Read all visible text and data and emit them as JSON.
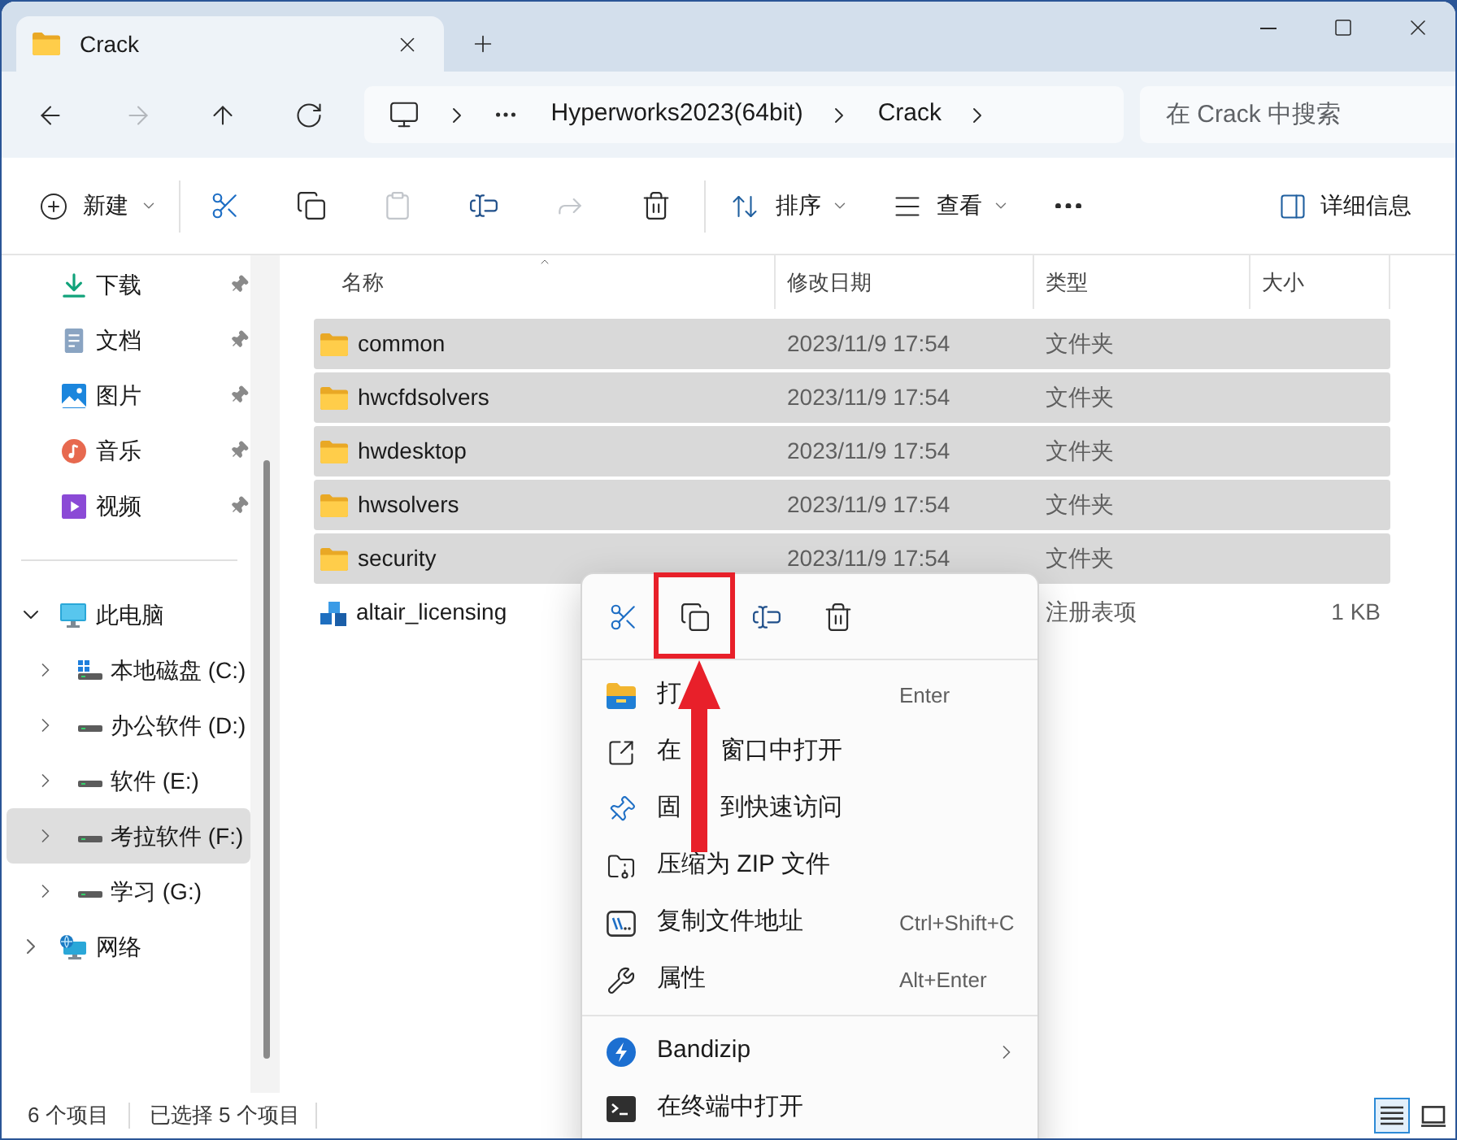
{
  "window": {
    "tabs": [
      {
        "label": "Crack",
        "selected": true
      }
    ]
  },
  "nav_buttons": [
    {
      "disabled": false
    },
    {
      "disabled": true
    },
    {
      "disabled": false
    },
    {
      "disabled": false
    }
  ],
  "address_bar": {
    "segments": [
      "Hyperworks2023(64bit)",
      "Crack"
    ]
  },
  "search": {
    "placeholder": "在 Crack 中搜索"
  },
  "toolbar": {
    "new_button": {
      "label": "新建"
    },
    "edit_actions": [
      {
        "disabled": false
      },
      {
        "disabled": false
      },
      {
        "disabled": true
      },
      {
        "disabled": false
      },
      {
        "disabled": true
      },
      {
        "disabled": false
      }
    ],
    "sort_button": {
      "label": "排序"
    },
    "view_button": {
      "label": "查看"
    },
    "details_button": {
      "label": "详细信息"
    }
  },
  "sidebar": {
    "quick_access": [
      {
        "label": "下载",
        "pinned": true
      },
      {
        "label": "文档",
        "pinned": true
      },
      {
        "label": "图片",
        "pinned": true
      },
      {
        "label": "音乐",
        "pinned": true
      },
      {
        "label": "视频",
        "pinned": true
      }
    ],
    "this_pc": {
      "label": "此电脑",
      "expanded": true,
      "children": [
        {
          "label": "本地磁盘 (C:)",
          "expanded": false,
          "selected": false
        },
        {
          "label": "办公软件 (D:)",
          "expanded": false,
          "selected": false
        },
        {
          "label": "软件 (E:)",
          "expanded": false,
          "selected": false
        },
        {
          "label": "考拉软件 (F:)",
          "expanded": false,
          "selected": true
        },
        {
          "label": "学习 (G:)",
          "expanded": false,
          "selected": false
        }
      ]
    },
    "network": {
      "label": "网络",
      "expanded": false
    }
  },
  "file_list": {
    "columns": [
      {
        "label": "名称",
        "sorted": true
      },
      {
        "label": "修改日期",
        "sorted": false
      },
      {
        "label": "类型",
        "sorted": false
      },
      {
        "label": "大小",
        "sorted": false
      }
    ],
    "rows": [
      {
        "kind": "folder",
        "name": "common",
        "modified": "2023/11/9 17:54",
        "type": "文件夹",
        "selected": true
      },
      {
        "kind": "folder",
        "name": "hwcfdsolvers",
        "modified": "2023/11/9 17:54",
        "type": "文件夹",
        "selected": true
      },
      {
        "kind": "folder",
        "name": "hwdesktop",
        "modified": "2023/11/9 17:54",
        "type": "文件夹",
        "selected": true
      },
      {
        "kind": "folder",
        "name": "hwsolvers",
        "modified": "2023/11/9 17:54",
        "type": "文件夹",
        "selected": true
      },
      {
        "kind": "folder",
        "name": "security",
        "modified": "2023/11/9 17:54",
        "type": "文件夹",
        "selected": true
      },
      {
        "kind": "registry",
        "name": "altair_licensing",
        "type": "注册表项",
        "size": "1 KB",
        "selected": false
      }
    ]
  },
  "context_menu": {
    "quick_actions": [
      {
        "highlighted": false
      },
      {
        "highlighted": true
      },
      {
        "highlighted": false
      },
      {
        "highlighted": false
      }
    ],
    "groups": [
      [
        {
          "label_parts": [
            "打"
          ],
          "shortcut": "Enter"
        },
        {
          "label_parts": [
            "在",
            "窗口中打开"
          ]
        },
        {
          "label_parts": [
            "固",
            "到快速访问"
          ]
        },
        {
          "label_parts": [
            "压缩为 ZIP 文件"
          ]
        },
        {
          "label_parts": [
            "复制文件地址"
          ],
          "shortcut": "Ctrl+Shift+C"
        },
        {
          "label_parts": [
            "属性"
          ],
          "shortcut": "Alt+Enter"
        }
      ],
      [
        {
          "label_parts": [
            "Bandizip"
          ],
          "submenu": true
        },
        {
          "label_parts": [
            "在终端中打开"
          ]
        }
      ]
    ]
  },
  "status_bar": {
    "item_count": "6 个项目",
    "selection": "已选择 5 个项目",
    "views": [
      {
        "selected": true
      },
      {
        "selected": false
      }
    ]
  }
}
